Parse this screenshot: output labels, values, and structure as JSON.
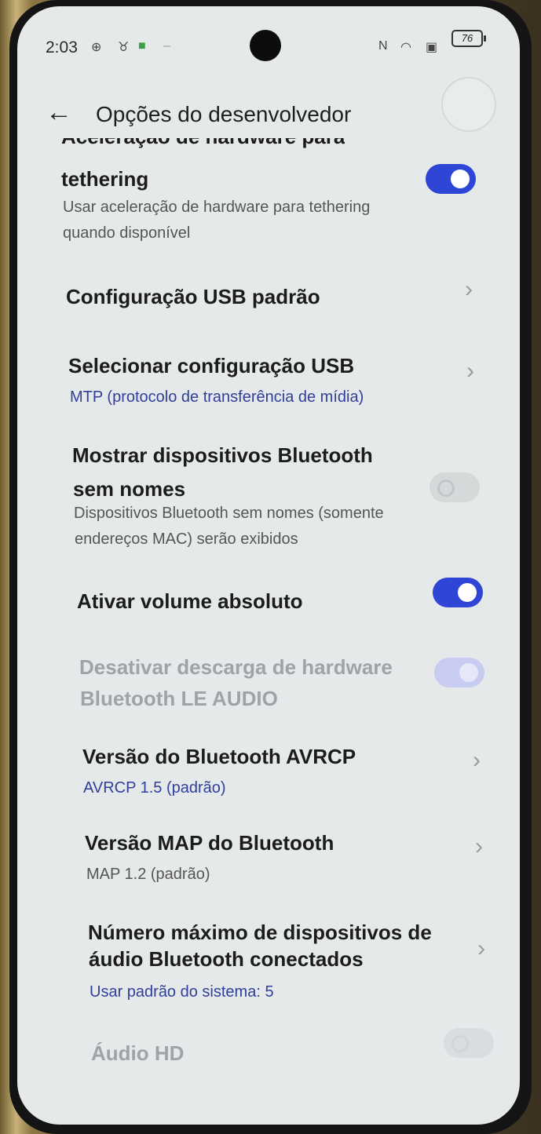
{
  "status": {
    "time": "2:03",
    "battery": "76"
  },
  "header": {
    "title": "Opções do desenvolvedor"
  },
  "items": [
    {
      "title_cut": "Aceleração de hardware para",
      "title": "tethering",
      "subtitle": "Usar aceleração de hardware para tethering",
      "subtitle2": "quando disponível",
      "control": "toggle-on"
    },
    {
      "title": "Configuração USB padrão",
      "control": "chevron"
    },
    {
      "title": "Selecionar configuração USB",
      "subtitle": "MTP (protocolo de transferência de mídia)",
      "control": "chevron"
    },
    {
      "title": "Mostrar dispositivos Bluetooth",
      "title2": "sem nomes",
      "subtitle": "Dispositivos Bluetooth sem nomes (somente",
      "subtitle2": "endereços MAC) serão exibidos",
      "control": "toggle-off"
    },
    {
      "title": "Ativar volume absoluto",
      "control": "toggle-on"
    },
    {
      "title": "Desativar descarga de hardware",
      "title2": "Bluetooth LE AUDIO",
      "control": "toggle-disabled-on"
    },
    {
      "title": "Versão do Bluetooth AVRCP",
      "subtitle": "AVRCP 1.5 (padrão)",
      "control": "chevron"
    },
    {
      "title": "Versão MAP do Bluetooth",
      "subtitle": "MAP 1.2 (padrão)",
      "control": "chevron"
    },
    {
      "title": "Número máximo de dispositivos de",
      "title2": "áudio Bluetooth conectados",
      "subtitle": "Usar padrão do sistema: 5",
      "control": "chevron"
    },
    {
      "title": "Áudio HD",
      "control": "toggle-disabled-off"
    }
  ],
  "icons": {
    "back": "arrow-left-icon",
    "chevron": "chevron-right-icon"
  },
  "colors": {
    "accent": "#2e45d6",
    "link": "#2f3f9a",
    "background": "#e6e9ea"
  }
}
